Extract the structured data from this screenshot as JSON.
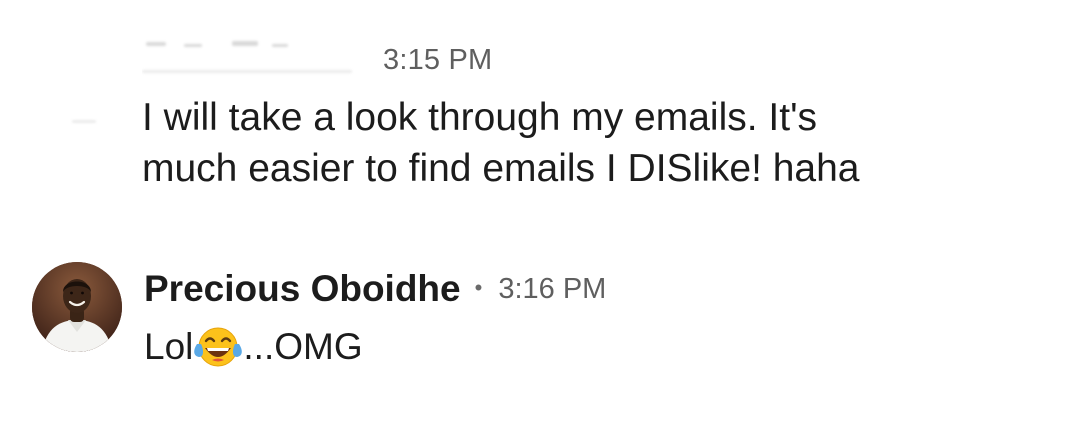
{
  "messages": [
    {
      "sender_redacted": true,
      "time": "3:15 PM",
      "text_lines": [
        "I will take a look through my emails. It's",
        "much easier to find emails I DISlike! haha"
      ]
    },
    {
      "sender": "Precious Oboidhe",
      "separator": "•",
      "time": "3:16 PM",
      "text_before_emoji": "Lol",
      "emoji": "face-with-tears-of-joy-icon",
      "text_after_emoji": "...OMG",
      "avatar": "profile-photo"
    }
  ],
  "colors": {
    "text": "#1c1c1c",
    "timestamp": "#5f5f5f",
    "background": "#ffffff"
  }
}
